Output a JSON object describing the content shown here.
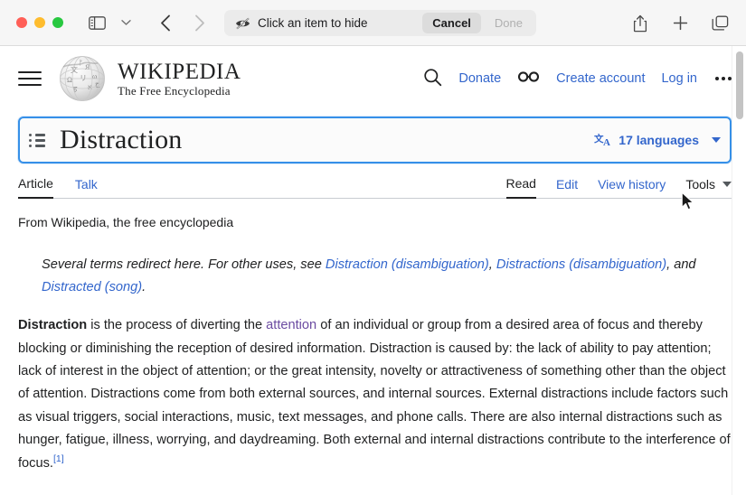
{
  "browser": {
    "traffic_lights": [
      "close",
      "minimize",
      "maximize"
    ],
    "sidebar_button_title": "Sidebar",
    "tab_overview_title": "Tab Overview",
    "back_title": "Back",
    "forward_title": "Forward",
    "share_title": "Share",
    "new_tab_title": "New Tab",
    "hide_banner": {
      "icon": "eye-slash-icon",
      "label": "Click an item to hide",
      "cancel_label": "Cancel",
      "done_label": "Done"
    }
  },
  "wiki_header": {
    "menu_icon": "hamburger-icon",
    "wordmark": "WIKIPEDIA",
    "wordmark_tagline": "The Free Encyclopedia",
    "search_icon": "search-icon",
    "donate_label": "Donate",
    "appearance_icon": "glasses-icon",
    "create_account_label": "Create account",
    "login_label": "Log in",
    "more_icon": "ellipsis-icon"
  },
  "title_block": {
    "toc_icon": "toc-list-icon",
    "title": "Distraction",
    "languages_icon": "translate-icon",
    "languages_label": "17 languages",
    "languages_chevron": "chevron-down-icon",
    "highlight_color": "#3690e8"
  },
  "tabs": {
    "left": [
      {
        "label": "Article",
        "active": true
      },
      {
        "label": "Talk",
        "active": false
      }
    ],
    "right": [
      {
        "label": "Read",
        "active": true
      },
      {
        "label": "Edit",
        "active": false
      },
      {
        "label": "View history",
        "active": false
      }
    ],
    "tools_label": "Tools",
    "tools_chevron": "chevron-down-icon"
  },
  "article": {
    "site_sub": "From Wikipedia, the free encyclopedia",
    "hatnote": {
      "prefix": "Several terms redirect here. For other uses, see ",
      "link1": "Distraction (disambiguation)",
      "sep1": ", ",
      "link2": "Distractions (disambiguation)",
      "sep2": ", and ",
      "link3": "Distracted (song)",
      "suffix": "."
    },
    "lead": {
      "bold_term": "Distraction",
      "part1": " is the process of diverting the ",
      "link_attention": "attention",
      "part2": " of an individual or group from a desired area of focus and thereby blocking or diminishing the reception of desired information. Distraction is caused by: the lack of ability to pay attention; lack of interest in the object of attention; or the great intensity, novelty or attractiveness of something other than the object of attention. Distractions come from both external sources, and internal sources. External distractions include factors such as visual triggers, social interactions, music, text messages, and phone calls. There are also internal distractions such as hunger, fatigue, illness, worrying, and daydreaming. Both external and internal distractions contribute to the interference of focus.",
      "citation": "[1]"
    }
  },
  "colors": {
    "link": "#3366cc",
    "visited_link": "#6b4ba1",
    "text": "#202122",
    "selection_border": "#3690e8"
  }
}
